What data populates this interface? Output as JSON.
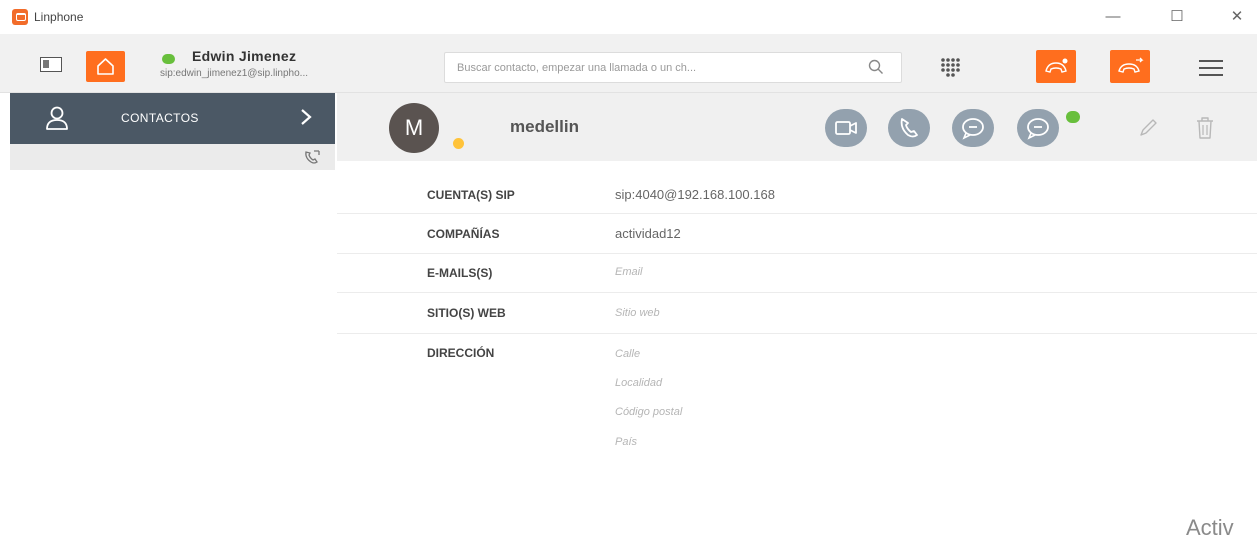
{
  "window": {
    "title": "Linphone",
    "controls": [
      "—",
      "☐",
      "✕"
    ]
  },
  "toolbar": {
    "user_name": "Edwin Jimenez",
    "user_sip": "sip:edwin_jimenez1@sip.linpho...",
    "search_placeholder": "Buscar contacto, empezar una llamada o un ch...",
    "accent_color": "#ff6e1e",
    "status_color": "#68bf3c"
  },
  "sidebar": {
    "contacts_label": "CONTACTOS",
    "background_color": "#4b5865"
  },
  "contact": {
    "avatar_letter": "M",
    "name": "medellin",
    "actions": [
      "video-call",
      "call",
      "chat",
      "secure-chat"
    ]
  },
  "details": {
    "sip_label": "CUENTA(S) SIP",
    "sip_value": "sip:4040@192.168.100.168",
    "company_label": "COMPAÑÍAS",
    "company_value": "actividad12",
    "email_label": "E-MAILS(S)",
    "email_placeholder": "Email",
    "web_label": "SITIO(S) WEB",
    "web_placeholder": "Sitio web",
    "address_label": "DIRECCIÓN",
    "address_street": "Calle",
    "address_locality": "Localidad",
    "address_postal": "Código postal",
    "address_country": "País"
  },
  "watermark": "Activ"
}
